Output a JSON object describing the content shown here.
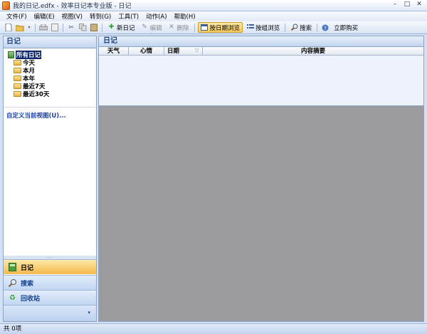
{
  "window": {
    "title": "我的日记.edfx - 效率日记本专业版 - 日记",
    "minimize": "–",
    "maximize": "□",
    "close": "✕"
  },
  "menu": [
    {
      "label": "文件(F)"
    },
    {
      "label": "编辑(E)"
    },
    {
      "label": "视图(V)"
    },
    {
      "label": "转到(G)"
    },
    {
      "label": "工具(T)"
    },
    {
      "label": "动作(A)"
    },
    {
      "label": "帮助(H)"
    }
  ],
  "toolbar": {
    "new_diary": "新日记",
    "edit": "编辑",
    "delete": "删除",
    "browse_by_date": "按日期浏览",
    "browse_by_group": "按组浏览",
    "search": "搜索",
    "buy_now": "立即购买"
  },
  "left_pane": {
    "title": "日记",
    "tree_root": "所有日记",
    "tree_items": [
      {
        "label": "今天"
      },
      {
        "label": "本月"
      },
      {
        "label": "本年"
      },
      {
        "label": "最近7天"
      },
      {
        "label": "最近30天"
      }
    ],
    "custom_view_link": "自定义当前视图(U)...",
    "grip": "....."
  },
  "nav_buttons": {
    "diary": "日记",
    "search": "搜索",
    "recycle_bin": "回收站",
    "chevron": "▾"
  },
  "right_pane": {
    "title": "日记",
    "columns": [
      "天气",
      "心情",
      "日期",
      "内容摘要"
    ],
    "sort_indicator": "▽"
  },
  "status": {
    "text": "共 0项"
  },
  "icons": {
    "new": "new-document-icon",
    "open": "open-folder-icon",
    "print": "print-icon",
    "cut": "cut-icon",
    "copy": "copy-icon",
    "paste": "paste-icon",
    "new_diary": "plus-icon",
    "edit": "pencil-icon",
    "delete": "x-icon",
    "search": "magnifier-icon",
    "help": "help-icon"
  },
  "colors": {
    "accent": "#f5b84b",
    "header_text": "#15428b",
    "workspace": "#9b9a9f"
  }
}
